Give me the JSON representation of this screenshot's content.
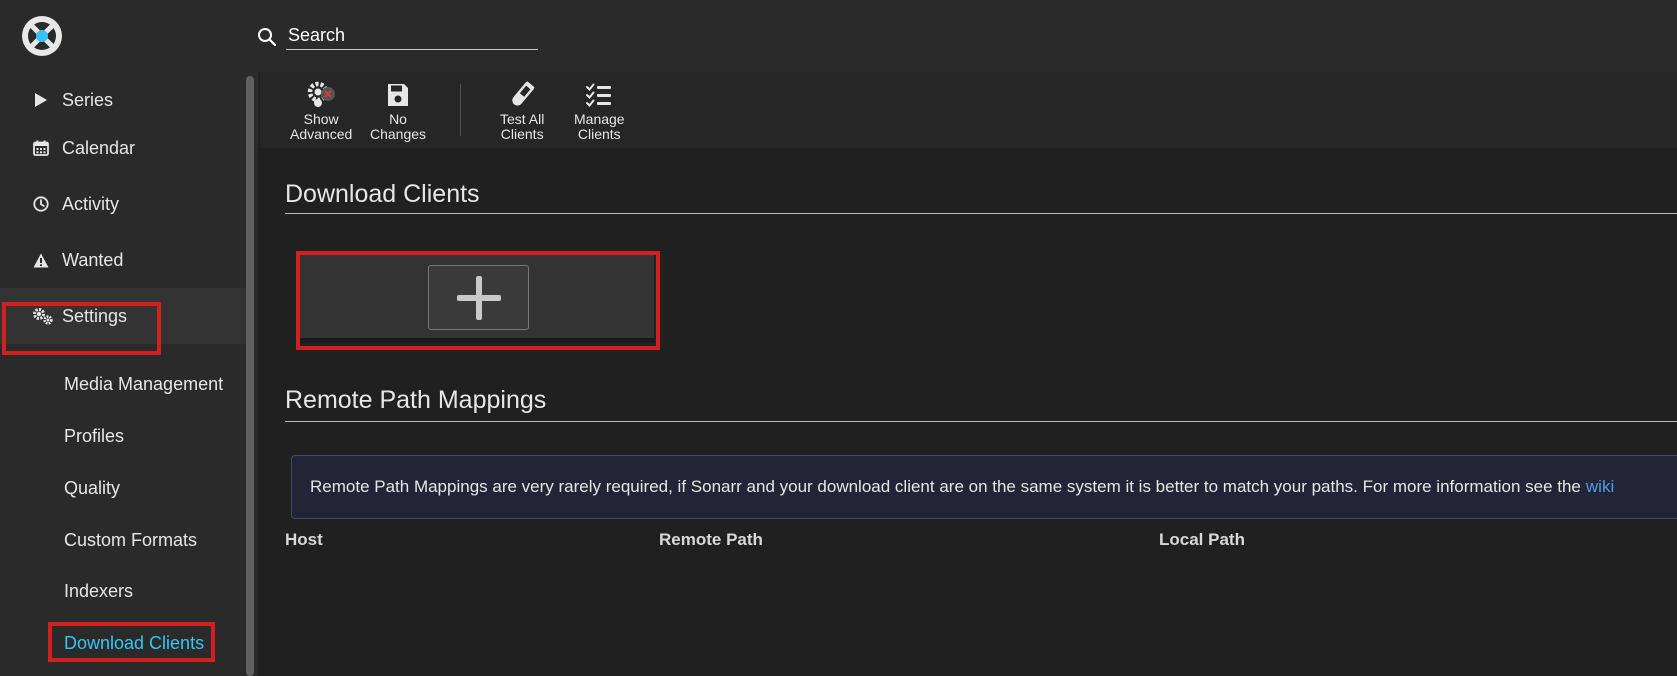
{
  "search": {
    "placeholder": "Search"
  },
  "nav": {
    "series": "Series",
    "calendar": "Calendar",
    "activity": "Activity",
    "wanted": "Wanted",
    "settings": "Settings"
  },
  "settings_sub": {
    "media_management": "Media Management",
    "profiles": "Profiles",
    "quality": "Quality",
    "custom_formats": "Custom Formats",
    "indexers": "Indexers",
    "download_clients": "Download Clients"
  },
  "toolbar": {
    "show_advanced_l1": "Show",
    "show_advanced_l2": "Advanced",
    "no_changes_l1": "No",
    "no_changes_l2": "Changes",
    "test_all_l1": "Test All",
    "test_all_l2": "Clients",
    "manage_l1": "Manage",
    "manage_l2": "Clients"
  },
  "main": {
    "download_clients_title": "Download Clients",
    "remote_path_title": "Remote Path Mappings",
    "info_text": "Remote Path Mappings are very rarely required, if Sonarr and your download client are on the same system it is better to match your paths. For more information see the",
    "info_link": "wiki",
    "columns": {
      "host": "Host",
      "remote_path": "Remote Path",
      "local_path": "Local Path"
    }
  },
  "colors": {
    "accent": "#35c5f4",
    "highlight": "#d21f1f",
    "link": "#4a9ee6"
  }
}
